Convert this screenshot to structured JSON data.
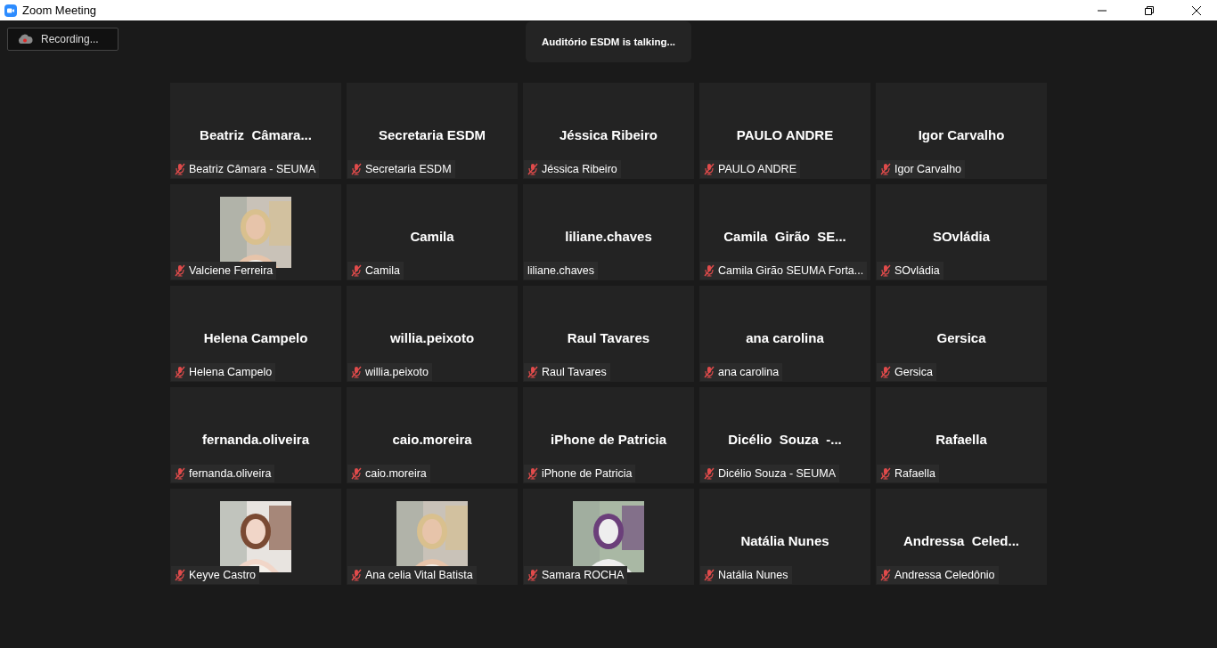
{
  "window": {
    "title": "Zoom Meeting"
  },
  "recording": {
    "label": "Recording..."
  },
  "talking": {
    "text": "Auditório ESDM is talking..."
  },
  "tiles": [
    {
      "kind": "name",
      "display": "Beatriz  Câmara...",
      "label": "Beatriz Câmara - SEUMA",
      "muted": true
    },
    {
      "kind": "name",
      "display": "Secretaria ESDM",
      "label": "Secretaria ESDM",
      "muted": true
    },
    {
      "kind": "name",
      "display": "Jéssica Ribeiro",
      "label": "Jéssica Ribeiro",
      "muted": true
    },
    {
      "kind": "name",
      "display": "PAULO ANDRE",
      "label": "PAULO ANDRE",
      "muted": true
    },
    {
      "kind": "name",
      "display": "Igor Carvalho",
      "label": "Igor Carvalho",
      "muted": true
    },
    {
      "kind": "picture",
      "label": "Valciene Ferreira",
      "muted": true
    },
    {
      "kind": "name",
      "display": "Camila",
      "label": "Camila",
      "muted": true
    },
    {
      "kind": "name",
      "display": "liliane.chaves",
      "label": "liliane.chaves",
      "muted": false
    },
    {
      "kind": "name",
      "display": "Camila  Girão  SE...",
      "label": "Camila Girão SEUMA Forta...",
      "muted": true
    },
    {
      "kind": "name",
      "display": "SOvládia",
      "label": "SOvládia",
      "muted": true
    },
    {
      "kind": "name",
      "display": "Helena Campelo",
      "label": "Helena Campelo",
      "muted": true
    },
    {
      "kind": "name",
      "display": "willia.peixoto",
      "label": "willia.peixoto",
      "muted": true
    },
    {
      "kind": "name",
      "display": "Raul Tavares",
      "label": "Raul Tavares",
      "muted": true
    },
    {
      "kind": "name",
      "display": "ana carolina",
      "label": "ana carolina",
      "muted": true
    },
    {
      "kind": "name",
      "display": "Gersica",
      "label": "Gersica",
      "muted": true
    },
    {
      "kind": "name",
      "display": "fernanda.oliveira",
      "label": "fernanda.oliveira",
      "muted": true
    },
    {
      "kind": "name",
      "display": "caio.moreira",
      "label": "caio.moreira",
      "muted": true
    },
    {
      "kind": "name",
      "display": "iPhone de Patricia",
      "label": "iPhone de Patricia",
      "muted": true
    },
    {
      "kind": "name",
      "display": "Dicélio  Souza  -...",
      "label": "Dicélio Souza - SEUMA",
      "muted": true
    },
    {
      "kind": "name",
      "display": "Rafaella",
      "label": "Rafaella",
      "muted": true
    },
    {
      "kind": "picture",
      "label": "Keyve Castro",
      "muted": true
    },
    {
      "kind": "picture",
      "label": "Ana celia Vital Batista",
      "muted": true
    },
    {
      "kind": "picture",
      "label": "Samara ROCHA",
      "muted": true
    },
    {
      "kind": "name",
      "display": "Natália Nunes",
      "label": "Natália Nunes",
      "muted": true
    },
    {
      "kind": "name",
      "display": "Andressa  Celed...",
      "label": "Andressa Celedônio",
      "muted": true
    }
  ]
}
